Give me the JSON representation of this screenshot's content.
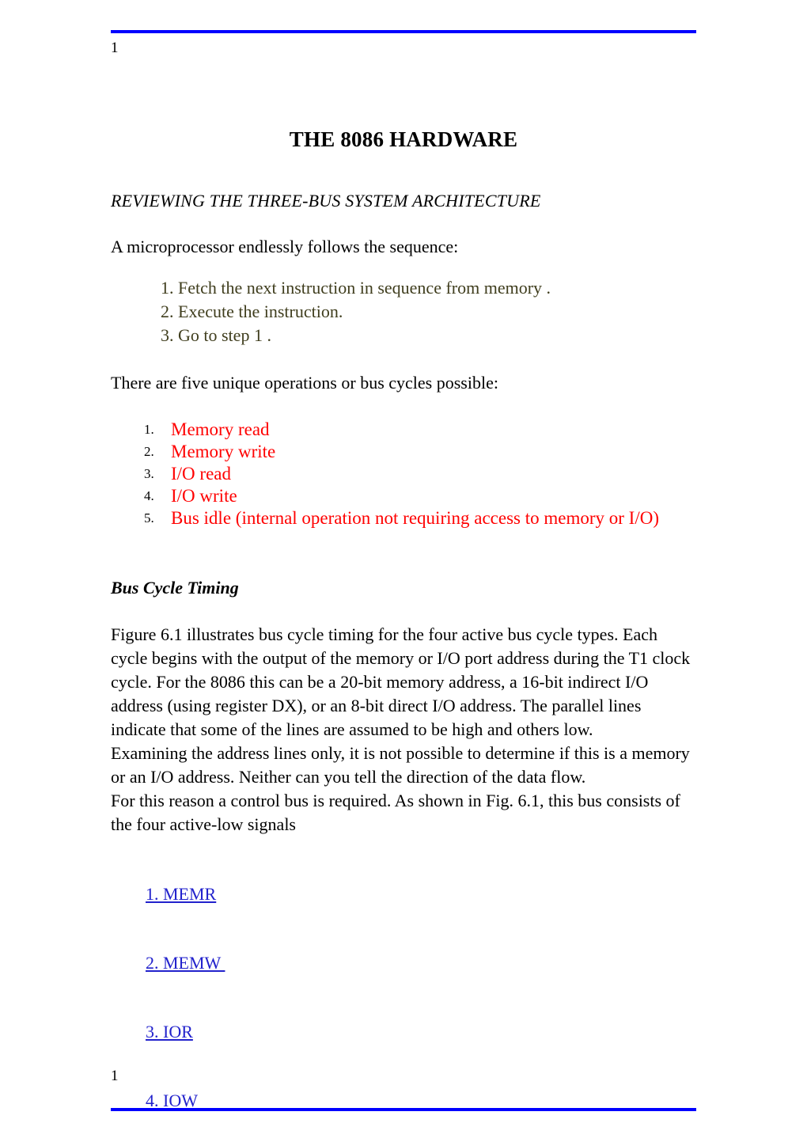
{
  "header": {
    "folio": "1"
  },
  "footer": {
    "folio": "1"
  },
  "colors": {
    "rule": "#0000ff",
    "olive_text": "#3f3d1d",
    "red_text": "#ff0000",
    "link_blue": "#2222cc",
    "body_text": "#000000"
  },
  "document": {
    "title": "THE 8086 HARDWARE",
    "subtitle": "REVIEWING THE THREE-BUS SYSTEM ARCHITECTURE",
    "intro_paragraph": "A microprocessor endlessly follows the sequence:",
    "sequence_steps": [
      "1. Fetch the next instruction in sequence from memory .",
      "2. Execute the instruction.",
      "3. Go to step 1 ."
    ],
    "bus_cycles_intro": "There are five unique operations or bus cycles possible:",
    "bus_cycles": [
      "Memory read",
      "Memory write",
      "I/O read",
      "I/O write",
      "Bus idle (internal operation not requiring access to memory or I/O)"
    ],
    "timing_heading": "Bus Cycle Timing",
    "timing_paragraphs": [
      "Figure 6.1 illustrates bus cycle timing for the four active bus cycle types. Each cycle begins with the output of the memory or I/O port address during the T1 clock cycle. For the 8086 this can be a 20-bit memory address, a 16-bit indirect I/O address (using register DX), or an 8-bit direct I/O address. The parallel lines indicate that some of the lines are assumed to be high and others low.",
      "Examining the address lines only, it is not possible to determine if this is a memory or an I/O address. Neither can you tell the direction of the data flow.",
      "For this reason a control bus is required. As shown in Fig. 6.1, this bus consists of the four active-low signals"
    ],
    "control_signals": [
      {
        "marker": "1. ",
        "label": "MEMR"
      },
      {
        "marker": "2. ",
        "label": "MEMW "
      },
      {
        "marker": "3. ",
        "label": "IOR"
      },
      {
        "marker": "4. ",
        "label": "IOW"
      }
    ]
  }
}
